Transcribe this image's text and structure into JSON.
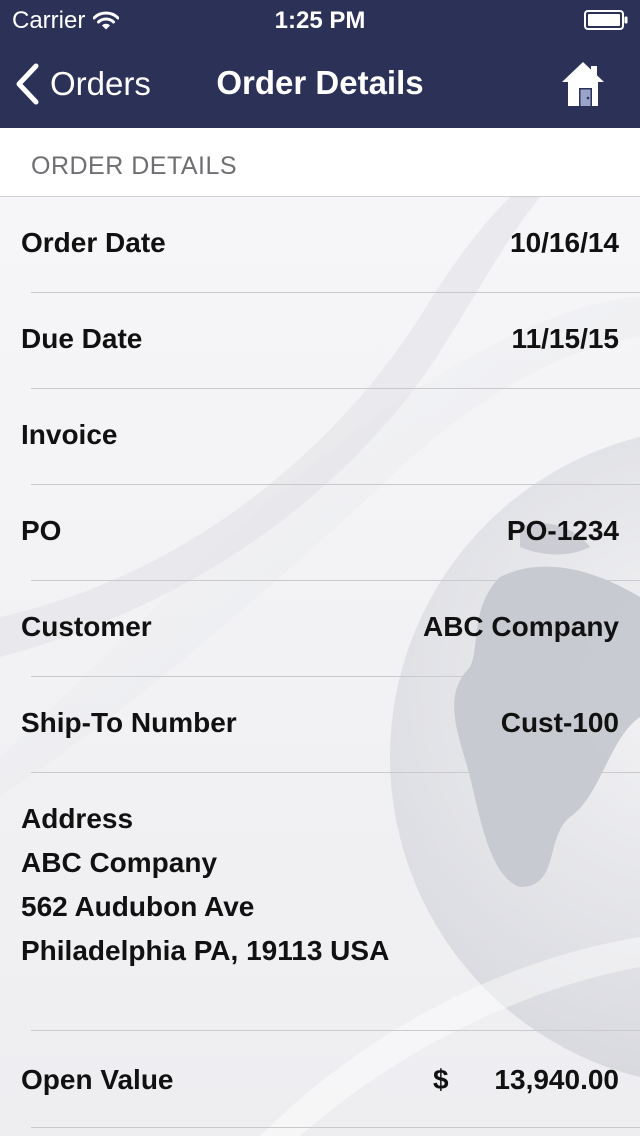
{
  "status_bar": {
    "carrier": "Carrier",
    "time": "1:25 PM"
  },
  "nav": {
    "back_label": "Orders",
    "title": "Order Details"
  },
  "section": {
    "header": "ORDER DETAILS"
  },
  "rows": [
    {
      "label": "Order Date",
      "value": "10/16/14"
    },
    {
      "label": "Due Date",
      "value": "11/15/15"
    },
    {
      "label": "Invoice",
      "value": ""
    },
    {
      "label": "PO",
      "value": "PO-1234"
    },
    {
      "label": "Customer",
      "value": "ABC Company"
    },
    {
      "label": "Ship-To Number",
      "value": "Cust-100"
    }
  ],
  "address": {
    "label": "Address",
    "lines": [
      "ABC Company",
      "562 Audubon Ave",
      "Philadelphia PA, 19113 USA"
    ]
  },
  "open_value": {
    "label": "Open Value",
    "currency": "$",
    "amount": "13,940.00"
  },
  "colors": {
    "nav_background": "#2c3158",
    "section_header_text": "#6f6f73",
    "separator": "#c9c9ce"
  },
  "icons": {
    "wifi": "wifi-icon",
    "battery": "battery-icon",
    "back": "back-chevron-icon",
    "home": "home-icon"
  }
}
